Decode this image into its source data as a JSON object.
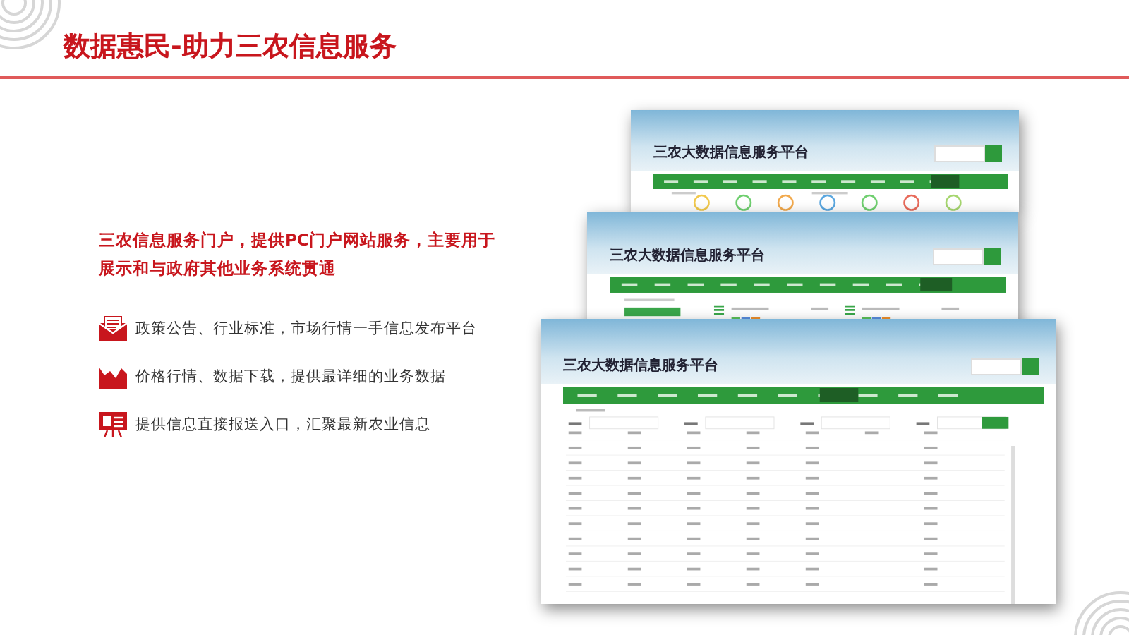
{
  "header": {
    "title": "数据惠民-助力三农信息服务"
  },
  "intro": "三农信息服务门户，提供PC门户网站服务，主要用于展示和与政府其他业务系统贯通",
  "features": [
    {
      "kind": "mail",
      "text": "政策公告、行业标准，市场行情一手信息发布平台"
    },
    {
      "kind": "chart",
      "text": "价格行情、数据下载，提供最详细的业务数据"
    },
    {
      "kind": "report",
      "text": "提供信息直接报送入口，汇聚最新农业信息"
    }
  ],
  "screenshots": [
    {
      "kind": "icons",
      "title": "三农大数据信息服务平台"
    },
    {
      "kind": "lists",
      "title": "三农大数据信息服务平台"
    },
    {
      "kind": "table",
      "title": "三农大数据信息服务平台"
    }
  ]
}
